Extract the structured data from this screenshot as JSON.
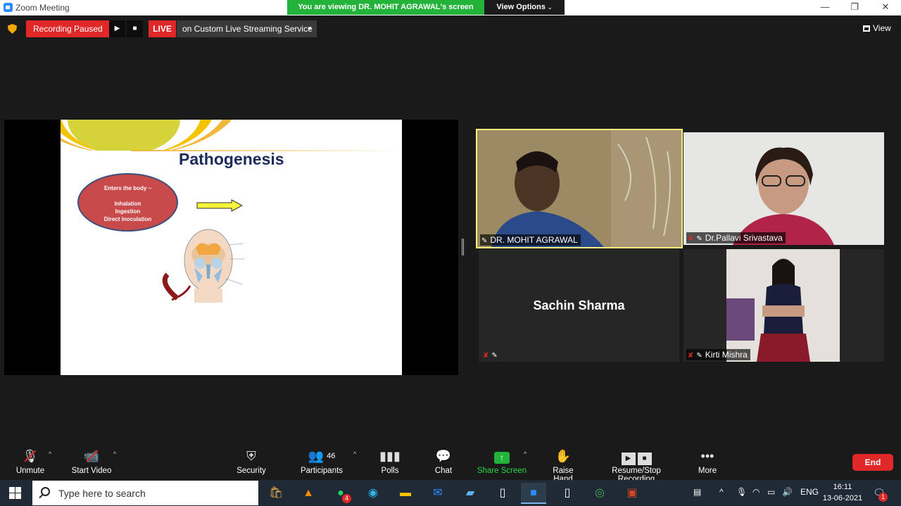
{
  "window": {
    "title": "Zoom Meeting",
    "viewing_banner": "You are viewing DR. MOHIT AGRAWAL's screen",
    "view_options": "View Options",
    "minimize": "—",
    "maximize": "❐",
    "close": "✕"
  },
  "topbar": {
    "recording_status": "Recording Paused",
    "live_badge": "LIVE",
    "stream_service": "on Custom Live Streaming Service",
    "view_label": "View"
  },
  "slide": {
    "title": "Pathogenesis",
    "ellipse_heading": "Enters the body –",
    "routes": [
      "Inhalation",
      "Ingestion",
      "Direct inoculation"
    ],
    "arrow_color": "#f7f23a",
    "ellipse_color": "#c84a4a"
  },
  "participants": [
    {
      "name": "DR. MOHIT AGRAWAL",
      "video": true,
      "active_speaker": true,
      "muted": false
    },
    {
      "name": "Dr.Pallavi Srivastava",
      "video": true,
      "active_speaker": false,
      "muted": true
    },
    {
      "name": "Sachin Sharma",
      "video": false,
      "active_speaker": false,
      "muted": true
    },
    {
      "name": "Kirti Mishra",
      "video": true,
      "active_speaker": false,
      "muted": true
    }
  ],
  "toolbar": {
    "unmute": "Unmute",
    "start_video": "Start Video",
    "security": "Security",
    "participants": "Participants",
    "participants_count": "46",
    "polls": "Polls",
    "chat": "Chat",
    "share_screen": "Share Screen",
    "raise_hand": "Raise Hand",
    "recording": "Resume/Stop Recording",
    "more": "More",
    "end": "End"
  },
  "taskbar": {
    "search_placeholder": "Type here to search",
    "whatsapp_badge": "4",
    "language": "ENG",
    "time": "16:11",
    "date": "13-06-2021",
    "notification_count": "1"
  },
  "colors": {
    "share_green": "#23b33a",
    "recording_red": "#e02828",
    "speaker_highlight": "#f5f17a"
  }
}
